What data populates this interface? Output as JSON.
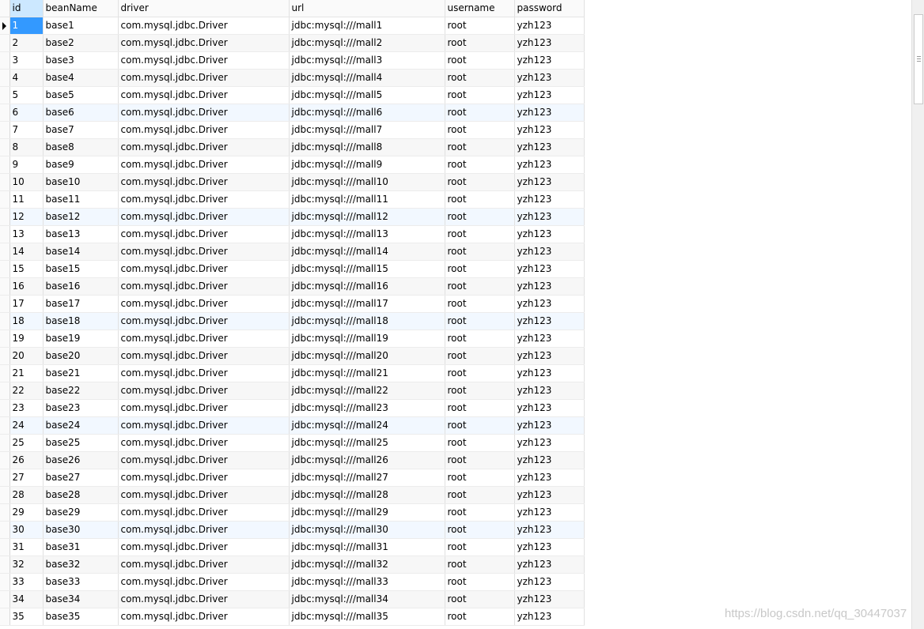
{
  "grid": {
    "columns": [
      "id",
      "beanName",
      "driver",
      "url",
      "username",
      "password"
    ],
    "rows": [
      [
        "1",
        "base1",
        "com.mysql.jdbc.Driver",
        "jdbc:mysql:///mall1",
        "root",
        "yzh123"
      ],
      [
        "2",
        "base2",
        "com.mysql.jdbc.Driver",
        "jdbc:mysql:///mall2",
        "root",
        "yzh123"
      ],
      [
        "3",
        "base3",
        "com.mysql.jdbc.Driver",
        "jdbc:mysql:///mall3",
        "root",
        "yzh123"
      ],
      [
        "4",
        "base4",
        "com.mysql.jdbc.Driver",
        "jdbc:mysql:///mall4",
        "root",
        "yzh123"
      ],
      [
        "5",
        "base5",
        "com.mysql.jdbc.Driver",
        "jdbc:mysql:///mall5",
        "root",
        "yzh123"
      ],
      [
        "6",
        "base6",
        "com.mysql.jdbc.Driver",
        "jdbc:mysql:///mall6",
        "root",
        "yzh123"
      ],
      [
        "7",
        "base7",
        "com.mysql.jdbc.Driver",
        "jdbc:mysql:///mall7",
        "root",
        "yzh123"
      ],
      [
        "8",
        "base8",
        "com.mysql.jdbc.Driver",
        "jdbc:mysql:///mall8",
        "root",
        "yzh123"
      ],
      [
        "9",
        "base9",
        "com.mysql.jdbc.Driver",
        "jdbc:mysql:///mall9",
        "root",
        "yzh123"
      ],
      [
        "10",
        "base10",
        "com.mysql.jdbc.Driver",
        "jdbc:mysql:///mall10",
        "root",
        "yzh123"
      ],
      [
        "11",
        "base11",
        "com.mysql.jdbc.Driver",
        "jdbc:mysql:///mall11",
        "root",
        "yzh123"
      ],
      [
        "12",
        "base12",
        "com.mysql.jdbc.Driver",
        "jdbc:mysql:///mall12",
        "root",
        "yzh123"
      ],
      [
        "13",
        "base13",
        "com.mysql.jdbc.Driver",
        "jdbc:mysql:///mall13",
        "root",
        "yzh123"
      ],
      [
        "14",
        "base14",
        "com.mysql.jdbc.Driver",
        "jdbc:mysql:///mall14",
        "root",
        "yzh123"
      ],
      [
        "15",
        "base15",
        "com.mysql.jdbc.Driver",
        "jdbc:mysql:///mall15",
        "root",
        "yzh123"
      ],
      [
        "16",
        "base16",
        "com.mysql.jdbc.Driver",
        "jdbc:mysql:///mall16",
        "root",
        "yzh123"
      ],
      [
        "17",
        "base17",
        "com.mysql.jdbc.Driver",
        "jdbc:mysql:///mall17",
        "root",
        "yzh123"
      ],
      [
        "18",
        "base18",
        "com.mysql.jdbc.Driver",
        "jdbc:mysql:///mall18",
        "root",
        "yzh123"
      ],
      [
        "19",
        "base19",
        "com.mysql.jdbc.Driver",
        "jdbc:mysql:///mall19",
        "root",
        "yzh123"
      ],
      [
        "20",
        "base20",
        "com.mysql.jdbc.Driver",
        "jdbc:mysql:///mall20",
        "root",
        "yzh123"
      ],
      [
        "21",
        "base21",
        "com.mysql.jdbc.Driver",
        "jdbc:mysql:///mall21",
        "root",
        "yzh123"
      ],
      [
        "22",
        "base22",
        "com.mysql.jdbc.Driver",
        "jdbc:mysql:///mall22",
        "root",
        "yzh123"
      ],
      [
        "23",
        "base23",
        "com.mysql.jdbc.Driver",
        "jdbc:mysql:///mall23",
        "root",
        "yzh123"
      ],
      [
        "24",
        "base24",
        "com.mysql.jdbc.Driver",
        "jdbc:mysql:///mall24",
        "root",
        "yzh123"
      ],
      [
        "25",
        "base25",
        "com.mysql.jdbc.Driver",
        "jdbc:mysql:///mall25",
        "root",
        "yzh123"
      ],
      [
        "26",
        "base26",
        "com.mysql.jdbc.Driver",
        "jdbc:mysql:///mall26",
        "root",
        "yzh123"
      ],
      [
        "27",
        "base27",
        "com.mysql.jdbc.Driver",
        "jdbc:mysql:///mall27",
        "root",
        "yzh123"
      ],
      [
        "28",
        "base28",
        "com.mysql.jdbc.Driver",
        "jdbc:mysql:///mall28",
        "root",
        "yzh123"
      ],
      [
        "29",
        "base29",
        "com.mysql.jdbc.Driver",
        "jdbc:mysql:///mall29",
        "root",
        "yzh123"
      ],
      [
        "30",
        "base30",
        "com.mysql.jdbc.Driver",
        "jdbc:mysql:///mall30",
        "root",
        "yzh123"
      ],
      [
        "31",
        "base31",
        "com.mysql.jdbc.Driver",
        "jdbc:mysql:///mall31",
        "root",
        "yzh123"
      ],
      [
        "32",
        "base32",
        "com.mysql.jdbc.Driver",
        "jdbc:mysql:///mall32",
        "root",
        "yzh123"
      ],
      [
        "33",
        "base33",
        "com.mysql.jdbc.Driver",
        "jdbc:mysql:///mall33",
        "root",
        "yzh123"
      ],
      [
        "34",
        "base34",
        "com.mysql.jdbc.Driver",
        "jdbc:mysql:///mall34",
        "root",
        "yzh123"
      ],
      [
        "35",
        "base35",
        "com.mysql.jdbc.Driver",
        "jdbc:mysql:///mall35",
        "root",
        "yzh123"
      ]
    ],
    "selected_row": 0,
    "colors": {
      "selection": "#3399ff",
      "header_selected": "#cce8ff",
      "alt_row": "#f7f7f7"
    }
  },
  "watermark": "https://blog.csdn.net/qq_30447037"
}
